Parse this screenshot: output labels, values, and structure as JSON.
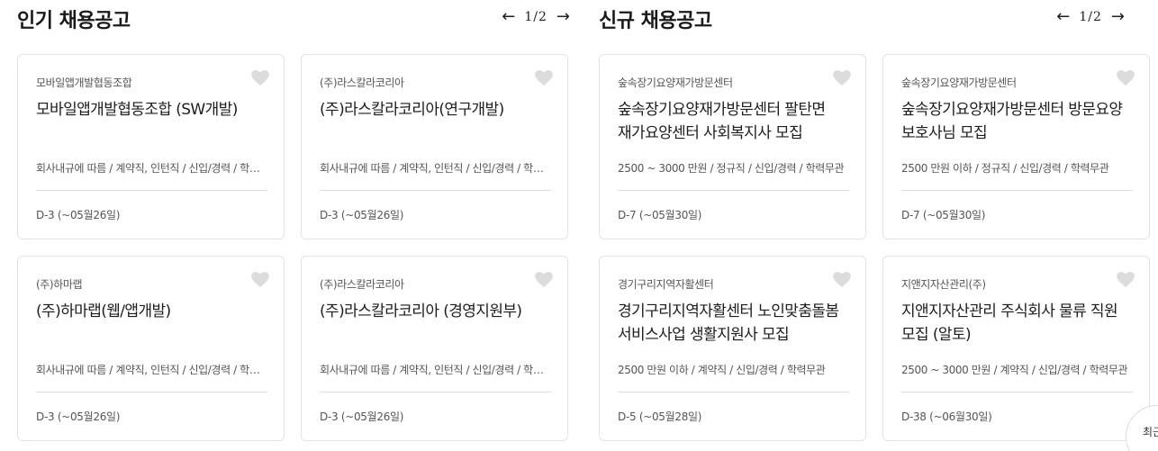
{
  "popular": {
    "title": "인기 채용공고",
    "pager": {
      "prev": "←",
      "count": "1/2",
      "next": "→"
    },
    "cards": [
      {
        "company": "모바일앱개발협동조합",
        "title": "모바일앱개발협동조합 (SW개발)",
        "conditions": "회사내규에 따름 / 계약직, 인턴직 / 신입/경력 / 학력무관",
        "deadline": "D-3 (~05월26일)"
      },
      {
        "company": "(주)라스칼라코리아",
        "title": "(주)라스칼라코리아(연구개발)",
        "conditions": "회사내규에 따름 / 계약직, 인턴직 / 신입/경력 / 학력무관",
        "deadline": "D-3 (~05월26일)"
      },
      {
        "company": "(주)하마랩",
        "title": "(주)하마랩(웹/앱개발)",
        "conditions": "회사내규에 따름 / 계약직, 인턴직 / 신입/경력 / 학력무관",
        "deadline": "D-3 (~05월26일)"
      },
      {
        "company": "(주)라스칼라코리아",
        "title": "(주)라스칼라코리아 (경영지원부)",
        "conditions": "회사내규에 따름 / 계약직, 인턴직 / 신입/경력 / 학력무관",
        "deadline": "D-3 (~05월26일)"
      }
    ]
  },
  "new_jobs": {
    "title": "신규 채용공고",
    "pager": {
      "prev": "←",
      "count": "1/2",
      "next": "→"
    },
    "cards": [
      {
        "company": "숲속장기요양재가방문센터",
        "title": "숲속장기요양재가방문센터 팔탄면 재가요양센터 사회복지사 모집",
        "conditions": "2500 ~ 3000 만원 / 정규직 / 신입/경력 / 학력무관",
        "deadline": "D-7 (~05월30일)"
      },
      {
        "company": "숲속장기요양재가방문센터",
        "title": "숲속장기요양재가방문센터 방문요양 보호사님 모집",
        "conditions": "2500 만원 이하 / 정규직 / 신입/경력 / 학력무관",
        "deadline": "D-7 (~05월30일)"
      },
      {
        "company": "경기구리지역자활센터",
        "title": "경기구리지역자활센터 노인맞춤돌봄 서비스사업 생활지원사 모집",
        "conditions": "2500 만원 이하 / 계약직 / 신입/경력 / 학력무관",
        "deadline": "D-5 (~05월28일)"
      },
      {
        "company": "지앤지자산관리(주)",
        "title": "지앤지자산관리 주식회사 물류 직원 모집 (알토)",
        "conditions": "2500 ~ 3000 만원 / 계약직 / 신입/경력 / 학력무관",
        "deadline": "D-38 (~06월30일)"
      }
    ]
  },
  "floating_button": {
    "label": "최근"
  },
  "colors": {
    "card_border": "#e3e3e3",
    "heart": "#dcdcdc",
    "text_primary": "#1d1d1d",
    "text_secondary": "#555555"
  },
  "icons": {
    "heart": "heart-icon",
    "prev": "arrow-left-icon",
    "next": "arrow-right-icon"
  }
}
